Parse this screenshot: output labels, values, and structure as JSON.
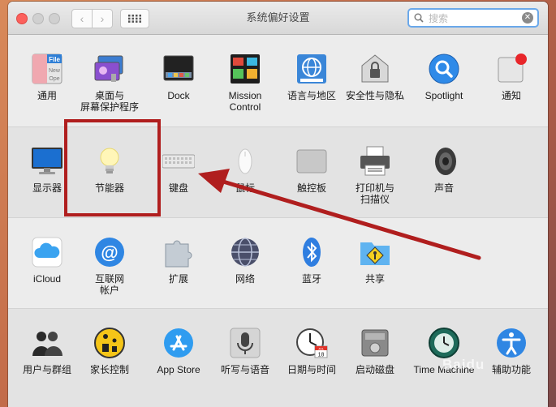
{
  "window": {
    "title": "系统偏好设置"
  },
  "search": {
    "placeholder": "搜索",
    "value": ""
  },
  "rows": [
    [
      {
        "label": "通用",
        "icon": "general-icon"
      },
      {
        "label": "桌面与\n屏幕保护程序",
        "icon": "desktop-screensaver-icon"
      },
      {
        "label": "Dock",
        "icon": "dock-icon"
      },
      {
        "label": "Mission\nControl",
        "icon": "mission-control-icon"
      },
      {
        "label": "语言与地区",
        "icon": "language-region-icon"
      },
      {
        "label": "安全性与隐私",
        "icon": "security-privacy-icon"
      },
      {
        "label": "Spotlight",
        "icon": "spotlight-icon"
      },
      {
        "label": "通知",
        "icon": "notifications-icon"
      }
    ],
    [
      {
        "label": "显示器",
        "icon": "displays-icon"
      },
      {
        "label": "节能器",
        "icon": "energy-saver-icon"
      },
      {
        "label": "键盘",
        "icon": "keyboard-icon"
      },
      {
        "label": "鼠标",
        "icon": "mouse-icon"
      },
      {
        "label": "触控板",
        "icon": "trackpad-icon"
      },
      {
        "label": "打印机与\n扫描仪",
        "icon": "printers-scanners-icon"
      },
      {
        "label": "声音",
        "icon": "sound-icon"
      }
    ],
    [
      {
        "label": "iCloud",
        "icon": "icloud-icon"
      },
      {
        "label": "互联网\n帐户",
        "icon": "internet-accounts-icon"
      },
      {
        "label": "扩展",
        "icon": "extensions-icon"
      },
      {
        "label": "网络",
        "icon": "network-icon"
      },
      {
        "label": "蓝牙",
        "icon": "bluetooth-icon"
      },
      {
        "label": "共享",
        "icon": "sharing-icon"
      }
    ],
    [
      {
        "label": "用户与群组",
        "icon": "users-groups-icon"
      },
      {
        "label": "家长控制",
        "icon": "parental-controls-icon"
      },
      {
        "label": "App Store",
        "icon": "app-store-icon"
      },
      {
        "label": "听写与语音",
        "icon": "dictation-speech-icon"
      },
      {
        "label": "日期与时间",
        "icon": "date-time-icon"
      },
      {
        "label": "启动磁盘",
        "icon": "startup-disk-icon"
      },
      {
        "label": "Time Machine",
        "icon": "time-machine-icon"
      },
      {
        "label": "辅助功能",
        "icon": "accessibility-icon"
      }
    ]
  ],
  "icon_texts": {
    "file_badge": "File",
    "file_new": "New",
    "file_ope": "Ope",
    "calendar_month": "JUL",
    "calendar_day": "18"
  },
  "watermark": "Baidu",
  "colors": {
    "highlight": "#b01e1e",
    "accent": "#3a8ee6"
  }
}
